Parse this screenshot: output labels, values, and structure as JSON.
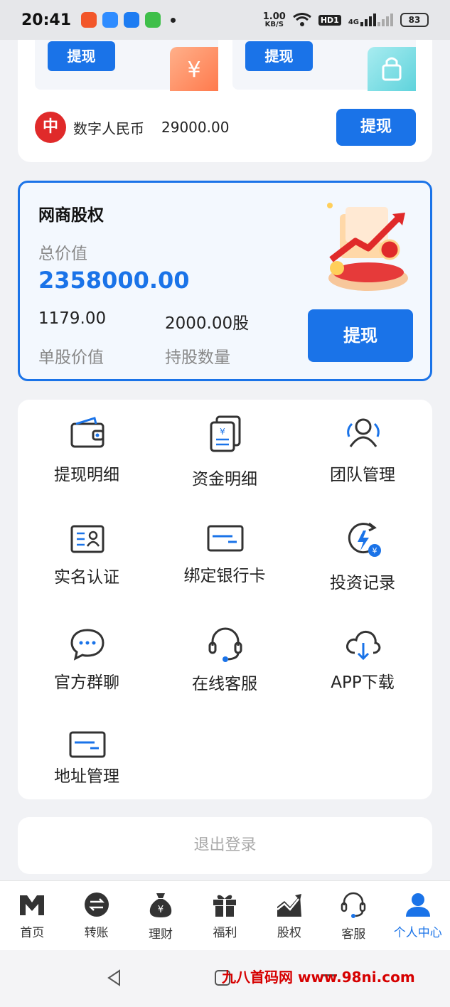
{
  "status_bar": {
    "time": "20:41",
    "net_speed_value": "1.00",
    "net_speed_unit": "KB/S",
    "hd_badge": "HD1",
    "network": "4G",
    "battery": "83"
  },
  "top_card": {
    "withdraw_label_1": "提现",
    "withdraw_label_2": "提现",
    "rmb_logo_char": "中",
    "rmb_name": "数字人民币",
    "rmb_amount": "29000.00",
    "rmb_withdraw_label": "提现",
    "icons": [
      "yuan-icon",
      "lock-icon"
    ]
  },
  "equity": {
    "title": "网商股权",
    "total_label": "总价值",
    "total_value": "2358000.00",
    "unit_price_value": "1179.00",
    "unit_price_label": "单股价值",
    "shares_value": "2000.00股",
    "shares_label": "持股数量",
    "withdraw_label": "提现"
  },
  "menu": {
    "items": [
      {
        "label": "提现明细",
        "icon": "wallet-icon"
      },
      {
        "label": "资金明细",
        "icon": "document-yuan-icon"
      },
      {
        "label": "团队管理",
        "icon": "team-icon"
      },
      {
        "label": "实名认证",
        "icon": "id-card-icon"
      },
      {
        "label": "绑定银行卡",
        "icon": "bank-card-icon"
      },
      {
        "label": "投资记录",
        "icon": "invest-history-icon"
      },
      {
        "label": "官方群聊",
        "icon": "chat-icon"
      },
      {
        "label": "在线客服",
        "icon": "headset-icon"
      },
      {
        "label": "APP下载",
        "icon": "cloud-download-icon"
      },
      {
        "label": "地址管理",
        "icon": "address-card-icon"
      }
    ]
  },
  "logout_label": "退出登录",
  "tabbar": {
    "items": [
      {
        "label": "首页",
        "icon": "home-logo-icon"
      },
      {
        "label": "转账",
        "icon": "transfer-icon"
      },
      {
        "label": "理财",
        "icon": "money-bag-icon"
      },
      {
        "label": "福利",
        "icon": "gift-icon"
      },
      {
        "label": "股权",
        "icon": "stock-chart-icon"
      },
      {
        "label": "客服",
        "icon": "headset-icon"
      },
      {
        "label": "个人中心",
        "icon": "user-icon"
      }
    ],
    "active_index": 6
  },
  "watermark": "九八首码网 www.98ni.com",
  "colors": {
    "accent": "#1a73e8",
    "page_bg": "#f1f2f5",
    "equity_bg": "#f3f8fe",
    "rmb_red": "#e02a2a",
    "watermark_red": "#d60000"
  }
}
